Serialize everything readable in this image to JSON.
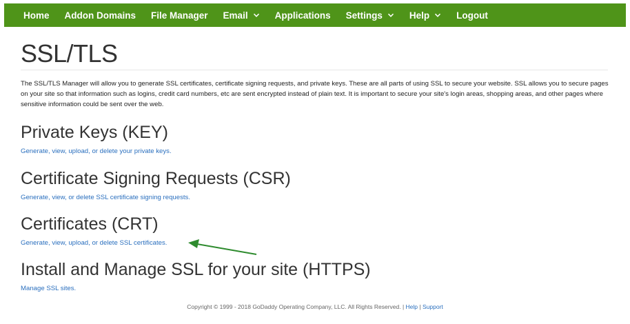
{
  "nav": {
    "items": [
      {
        "label": "Home",
        "dropdown": false
      },
      {
        "label": "Addon Domains",
        "dropdown": false
      },
      {
        "label": "File Manager",
        "dropdown": false
      },
      {
        "label": "Email",
        "dropdown": true
      },
      {
        "label": "Applications",
        "dropdown": false
      },
      {
        "label": "Settings",
        "dropdown": true
      },
      {
        "label": "Help",
        "dropdown": true
      },
      {
        "label": "Logout",
        "dropdown": false
      }
    ]
  },
  "page": {
    "title": "SSL/TLS",
    "intro": "The SSL/TLS Manager will allow you to generate SSL certificates, certificate signing requests, and private keys. These are all parts of using SSL to secure your website. SSL allows you to secure pages on your site so that information such as logins, credit card numbers, etc are sent encrypted instead of plain text. It is important to secure your site's login areas, shopping areas, and other pages where sensitive information could be sent over the web."
  },
  "sections": {
    "keys": {
      "heading": "Private Keys (KEY)",
      "link": "Generate, view, upload, or delete your private keys."
    },
    "csr": {
      "heading": "Certificate Signing Requests (CSR)",
      "link": "Generate, view, or delete SSL certificate signing requests."
    },
    "crt": {
      "heading": "Certificates (CRT)",
      "link": "Generate, view, upload, or delete SSL certificates."
    },
    "https": {
      "heading": "Install and Manage SSL for your site (HTTPS)",
      "link": "Manage SSL sites."
    }
  },
  "footer": {
    "copyright": "Copyright © 1999 - 2018 GoDaddy Operating Company, LLC. All Rights Reserved. |",
    "help_label": "Help",
    "separator": "|",
    "support_label": "Support"
  },
  "colors": {
    "nav_background": "#4f9419",
    "link": "#2a6fbe",
    "annotation_arrow": "#2e8b2e"
  }
}
